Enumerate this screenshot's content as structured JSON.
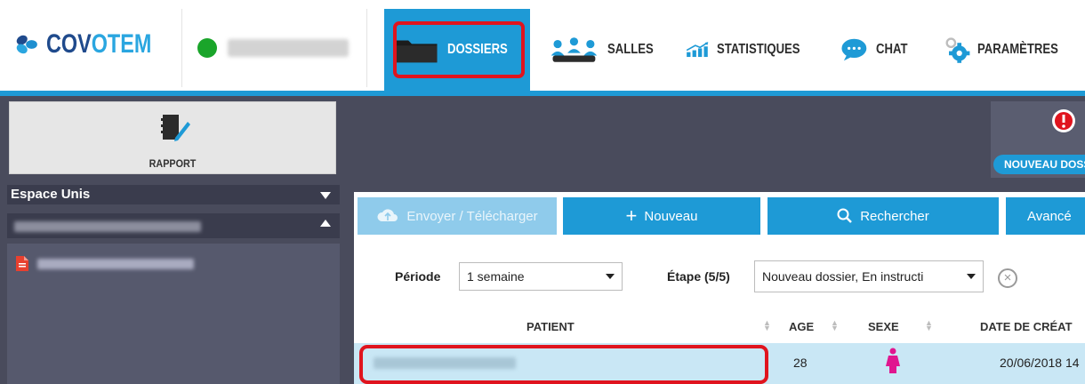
{
  "brand": {
    "name_part1": "COV",
    "name_part2": "OTEM"
  },
  "nav": {
    "dossiers": "DOSSIERS",
    "salles": "SALLES",
    "statistiques": "STATISTIQUES",
    "chat": "CHAT",
    "parametres": "PARAMÈTRES"
  },
  "colors": {
    "accent": "#1e9ad6",
    "dark": "#494b5c",
    "highlight": "#e0141e",
    "online": "#1aa52a"
  },
  "sidebar": {
    "rapport": "RAPPORT",
    "espace": "Espace Unis"
  },
  "main": {
    "new_button": "NOUVEAU DOSSIER"
  },
  "toolbar": {
    "envoyer": "Envoyer / Télécharger",
    "nouveau": "Nouveau",
    "rechercher": "Rechercher",
    "avance": "Avancé"
  },
  "filters": {
    "periode_label": "Période",
    "periode_value": "1 semaine",
    "etape_label": "Étape (5/5)",
    "etape_value": "Nouveau dossier, En instructi"
  },
  "table": {
    "headers": [
      "PATIENT",
      "AGE",
      "SEXE",
      "DATE DE CRÉAT"
    ],
    "rows": [
      {
        "age": "28",
        "date": "20/06/2018 14"
      }
    ]
  }
}
